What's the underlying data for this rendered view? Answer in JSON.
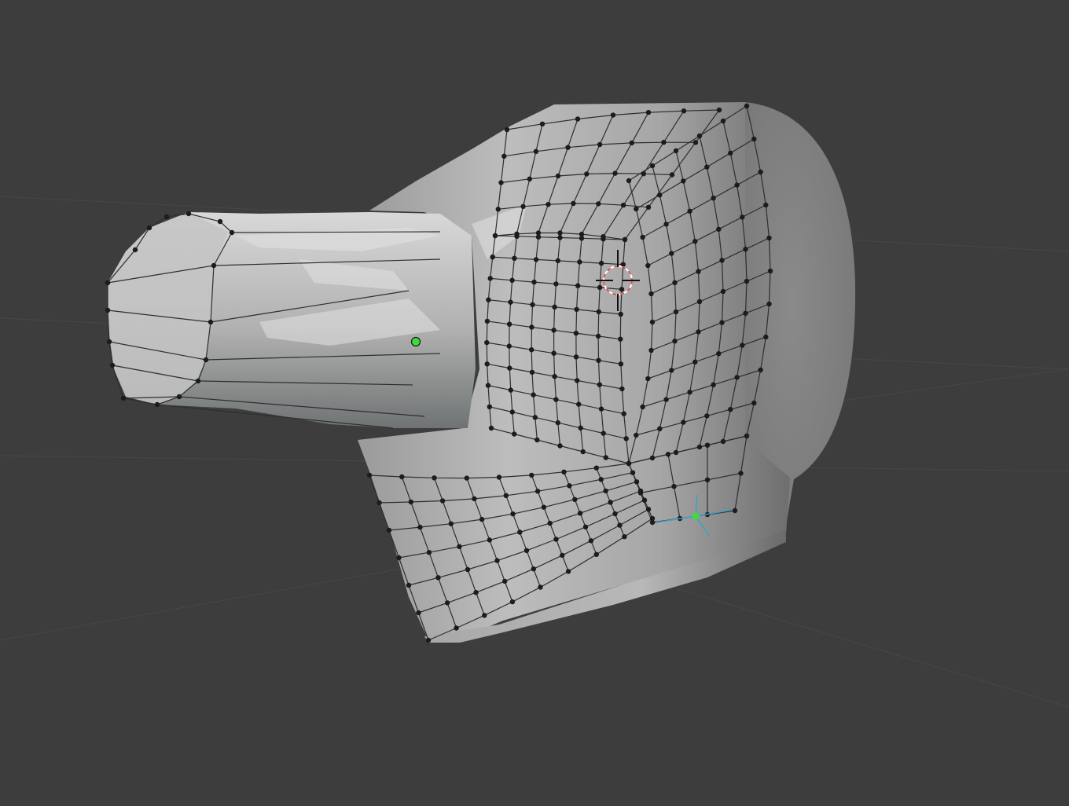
{
  "app": "3D viewport",
  "mode": "edit-mode-vertex",
  "colors": {
    "background": "#3d3d3d",
    "grid": "#4a4a4a",
    "mesh_base": "#8e8e8e",
    "mesh_light": "#d0d0d0",
    "wire": "#2b2b2b",
    "vertex": "#1a1a1a",
    "selected_vertex": "#3ddc3d",
    "cursor_ring": "#e05050"
  },
  "icons": [
    "3d-cursor-icon",
    "mesh-origin-icon",
    "selected-vertex-icon"
  ]
}
